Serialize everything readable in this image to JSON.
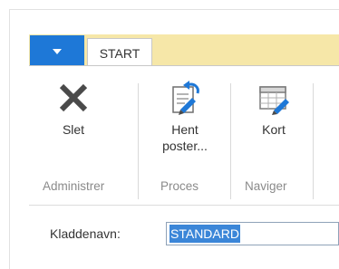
{
  "ribbon": {
    "menu_button": "menu",
    "tab_start": "START",
    "buttons": [
      {
        "label": "Slet",
        "icon": "delete-x-icon"
      },
      {
        "label": "Hent\nposter...",
        "icon": "fetch-entries-icon"
      },
      {
        "label": "Kort",
        "icon": "card-icon"
      }
    ],
    "groups": [
      "Administrer",
      "Proces",
      "Naviger"
    ]
  },
  "form": {
    "kladdenavn_label": "Kladdenavn:",
    "kladdenavn_value": "STANDARD"
  },
  "colors": {
    "accent_blue": "#1e78d7",
    "tabbar_yellow": "#f6e7a8",
    "selection_blue": "#3b86d8"
  }
}
